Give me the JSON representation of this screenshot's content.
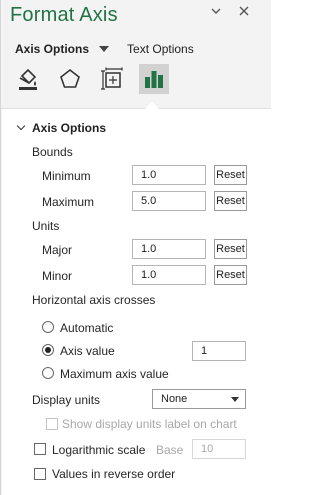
{
  "pane": {
    "title": "Format Axis",
    "tabs": [
      {
        "label": "Axis Options",
        "active": true
      },
      {
        "label": "Text Options",
        "active": false
      }
    ],
    "icon_tabs": [
      "fill-line-icon",
      "effects-icon",
      "size-properties-icon",
      "axis-options-icon"
    ]
  },
  "axis_options": {
    "header": "Axis Options",
    "bounds": {
      "label": "Bounds",
      "minimum": {
        "label": "Minimum",
        "value": "1.0",
        "reset": "Reset"
      },
      "maximum": {
        "label": "Maximum",
        "value": "5.0",
        "reset": "Reset"
      }
    },
    "units": {
      "label": "Units",
      "major": {
        "label": "Major",
        "value": "1.0",
        "reset": "Reset"
      },
      "minor": {
        "label": "Minor",
        "value": "1.0",
        "reset": "Reset"
      }
    },
    "crosses": {
      "label": "Horizontal axis crosses",
      "automatic": "Automatic",
      "axis_value": "Axis value",
      "axis_value_input": "1",
      "maximum": "Maximum axis value",
      "selected": "axis_value"
    },
    "display_units": {
      "label": "Display units",
      "value": "None",
      "show_label": "Show display units label on chart"
    },
    "log_scale": {
      "label": "Logarithmic scale",
      "base_label": "Base",
      "base_value": "10"
    },
    "reverse": {
      "label": "Values in reverse order"
    }
  },
  "colors": {
    "title": "#217346",
    "selected_tab": "#d2d2d2"
  }
}
